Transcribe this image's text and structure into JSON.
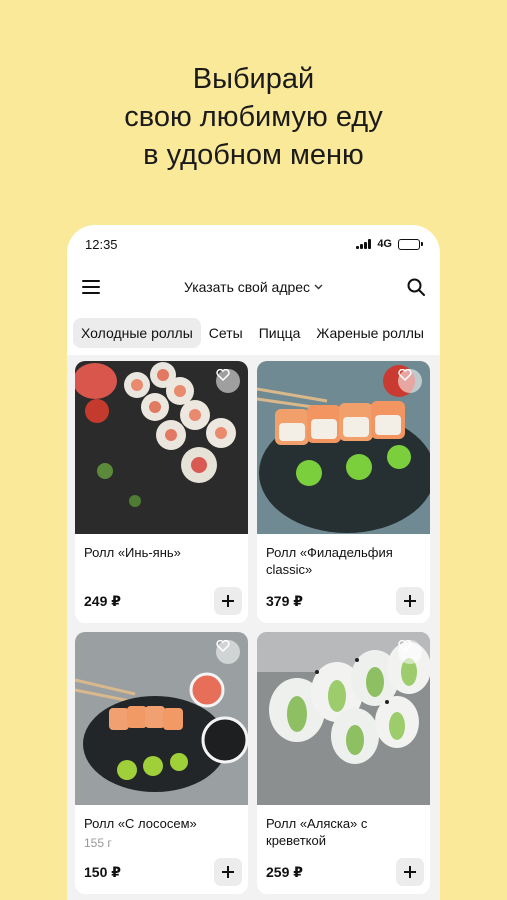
{
  "promo": {
    "line1": "Выбирай",
    "line2": "свою любимую еду",
    "line3": "в удобном меню"
  },
  "status": {
    "time": "12:35",
    "network": "4G"
  },
  "header": {
    "address_label": "Указать свой адрес",
    "chevron": "⌄"
  },
  "tabs": [
    {
      "label": "Холодные роллы",
      "active": true
    },
    {
      "label": "Сеты"
    },
    {
      "label": "Пицца"
    },
    {
      "label": "Жареные роллы"
    }
  ],
  "products": [
    {
      "name": "Ролл «Инь-янь»",
      "weight": "",
      "price": "249 ₽"
    },
    {
      "name": "Ролл «Филадельфия classic»",
      "weight": "",
      "price": "379 ₽"
    },
    {
      "name": "Ролл «С лососем»",
      "weight": "155 г",
      "price": "150 ₽"
    },
    {
      "name": "Ролл «Аляска» с креветкой",
      "weight": "",
      "price": "259 ₽"
    }
  ],
  "icons": {
    "menu": "hamburger-icon",
    "search": "search-icon",
    "favorite": "heart-icon",
    "add": "plus-icon"
  },
  "colors": {
    "background": "#fbe99a",
    "card": "#ffffff",
    "grid": "#f2f2f2",
    "tab_active": "#ececec"
  }
}
